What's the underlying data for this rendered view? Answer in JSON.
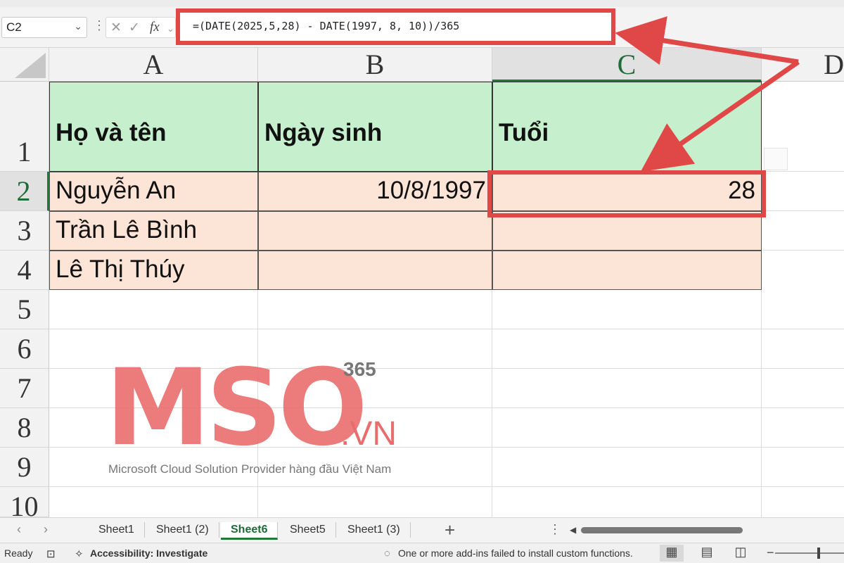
{
  "formula_bar": {
    "name_box": "C2",
    "formula": "=(DATE(2025,5,28) - DATE(1997, 8, 10))/365",
    "fx_label": "fx"
  },
  "columns": [
    "A",
    "B",
    "C",
    "D"
  ],
  "rows": [
    "1",
    "2",
    "3",
    "4",
    "5",
    "6",
    "7",
    "8",
    "9",
    "10"
  ],
  "table": {
    "headers": [
      "Họ và tên",
      "Ngày sinh",
      "Tuổi"
    ],
    "rows": [
      [
        "Nguyễn An",
        "10/8/1997",
        "28"
      ],
      [
        "Trần Lê Bình",
        "",
        ""
      ],
      [
        "Lê Thị Thúy",
        "",
        ""
      ]
    ]
  },
  "watermark": {
    "logo": "MSO",
    "superscript": "365",
    "domain": ".VN",
    "tagline": "Microsoft Cloud Solution Provider hàng đầu Việt Nam"
  },
  "sheets": [
    "Sheet1",
    "Sheet1 (2)",
    "Sheet6",
    "Sheet5",
    "Sheet1 (3)"
  ],
  "active_sheet": "Sheet6",
  "status": {
    "ready": "Ready",
    "accessibility": "Accessibility: Investigate",
    "message": "One or more add-ins failed to install custom functions."
  },
  "colors": {
    "annotation_red": "#e04848",
    "header_green": "#c6efce",
    "data_peach": "#fce4d6",
    "excel_green": "#1f7a3a"
  }
}
